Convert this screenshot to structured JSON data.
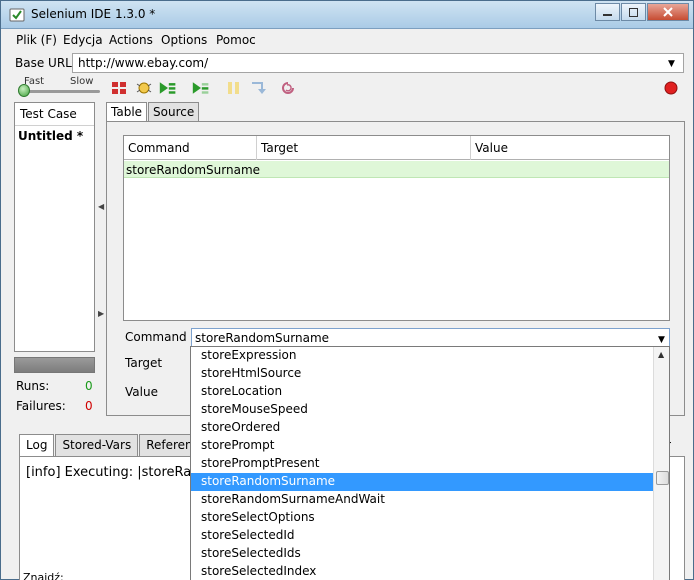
{
  "window": {
    "title": "Selenium IDE 1.3.0 *"
  },
  "menu": [
    "Plik (F)",
    "Edycja",
    "Actions",
    "Options",
    "Pomoc"
  ],
  "base_url": {
    "label": "Base URL",
    "value": "http://www.ebay.com/"
  },
  "speed": {
    "fast": "Fast",
    "slow": "Slow"
  },
  "left_pane": {
    "header": "Test Case",
    "items": [
      "Untitled *"
    ],
    "runs_label": "Runs:",
    "runs_value": "0",
    "failures_label": "Failures:",
    "failures_value": "0"
  },
  "tabs": [
    "Table",
    "Source"
  ],
  "table": {
    "headers": [
      "Command",
      "Target",
      "Value"
    ],
    "rows": [
      {
        "command": "storeRandomSurname",
        "target": "",
        "value": ""
      }
    ]
  },
  "editor": {
    "command_label": "Command",
    "command_value": "storeRandomSurname",
    "target_label": "Target",
    "value_label": "Value"
  },
  "log": {
    "tabs": [
      "Log",
      "Stored-Vars",
      "Reference"
    ],
    "line": "[info] Executing: |storeRan",
    "find_label": "Znajdź:",
    "right_cut": "r"
  },
  "dropdown": {
    "items": [
      "storeExpression",
      "storeHtmlSource",
      "storeLocation",
      "storeMouseSpeed",
      "storeOrdered",
      "storePrompt",
      "storePromptPresent",
      "storeRandomSurname",
      "storeRandomSurnameAndWait",
      "storeSelectOptions",
      "storeSelectedId",
      "storeSelectedIds",
      "storeSelectedIndex"
    ],
    "selected": "storeRandomSurname"
  },
  "colors": {
    "selection": "#3399ff",
    "row_highlight": "#dff7d8",
    "ok_green": "#1a9a1a",
    "fail_red": "#d00000"
  }
}
